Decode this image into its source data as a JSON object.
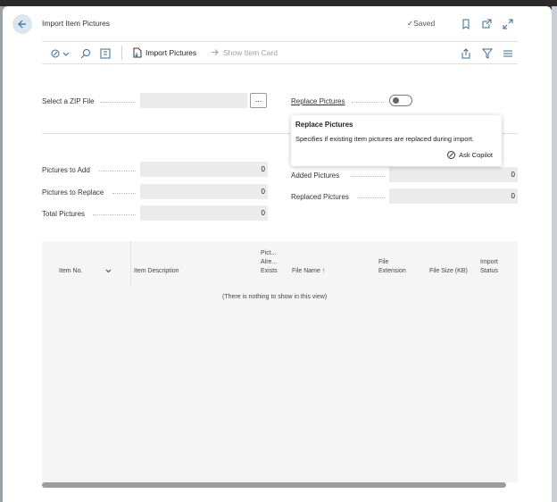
{
  "window": {
    "title": "Import Item Pictures",
    "saved_label": "Saved"
  },
  "toolbar": {
    "import_pictures": "Import Pictures",
    "show_item_card": "Show Item Card"
  },
  "form": {
    "zip_label": "Select a ZIP File",
    "zip_value": "",
    "assist_button": "...",
    "replace_label": "Replace Pictures",
    "replace_on": false,
    "pictures_to_add_label": "Pictures to Add",
    "pictures_to_add_value": "0",
    "pictures_to_replace_label": "Pictures to Replace",
    "pictures_to_replace_value": "0",
    "total_pictures_label": "Total Pictures",
    "total_pictures_value": "0",
    "added_pictures_label": "Added Pictures",
    "added_pictures_value": "0",
    "replaced_pictures_label": "Replaced Pictures",
    "replaced_pictures_value": "0"
  },
  "tooltip": {
    "title": "Replace Pictures",
    "body": "Specifies if existing item pictures are replaced during import.",
    "copilot": "Ask Copilot"
  },
  "grid": {
    "columns": {
      "item_no": "Item No.",
      "item_description": "Item Description",
      "picture_exists": [
        "Pict...",
        "Alre...",
        "Exists"
      ],
      "file_name": "File Name ↑",
      "file_extension": [
        "File",
        "Extension"
      ],
      "file_size": "File Size (KB)",
      "import_status": [
        "Import",
        "Status"
      ]
    },
    "empty_text": "(There is nothing to show in this view)"
  }
}
